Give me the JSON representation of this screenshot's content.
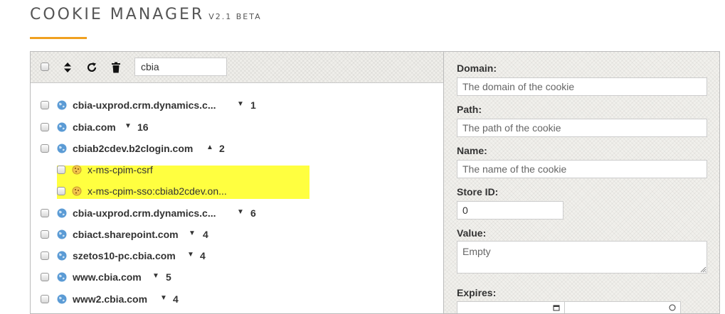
{
  "app": {
    "title": "COOKIE MANAGER",
    "version": "V2.1 BETA"
  },
  "toolbar": {
    "search_value": "cbia"
  },
  "domains_top": [
    {
      "name": "cbia-uxprod.crm.dynamics.c...",
      "arrow": "▼",
      "count": "1"
    },
    {
      "name": "cbia.com",
      "arrow": "▼",
      "count": "16"
    },
    {
      "name": "cbiab2cdev.b2clogin.com",
      "arrow": "▲",
      "count": "2"
    }
  ],
  "cookies": [
    {
      "name": "x-ms-cpim-csrf"
    },
    {
      "name": "x-ms-cpim-sso:cbiab2cdev.on..."
    }
  ],
  "domains_bottom": [
    {
      "name": "cbia-uxprod.crm.dynamics.c...",
      "arrow": "▼",
      "count": "6"
    },
    {
      "name": "cbiact.sharepoint.com",
      "arrow": "▼",
      "count": "4"
    },
    {
      "name": "szetos10-pc.cbia.com",
      "arrow": "▼",
      "count": "4"
    },
    {
      "name": "www.cbia.com",
      "arrow": "▼",
      "count": "5"
    },
    {
      "name": "www2.cbia.com",
      "arrow": "▼",
      "count": "4"
    }
  ],
  "form": {
    "domain_label": "Domain:",
    "domain_placeholder": "The domain of the cookie",
    "path_label": "Path:",
    "path_placeholder": "The path of the cookie",
    "name_label": "Name:",
    "name_placeholder": "The name of the cookie",
    "storeid_label": "Store ID:",
    "storeid_value": "0",
    "value_label": "Value:",
    "value_placeholder": "Empty",
    "expires_label": "Expires:"
  },
  "colors": {
    "accent": "#f0a020",
    "highlight": "#ffff40"
  }
}
